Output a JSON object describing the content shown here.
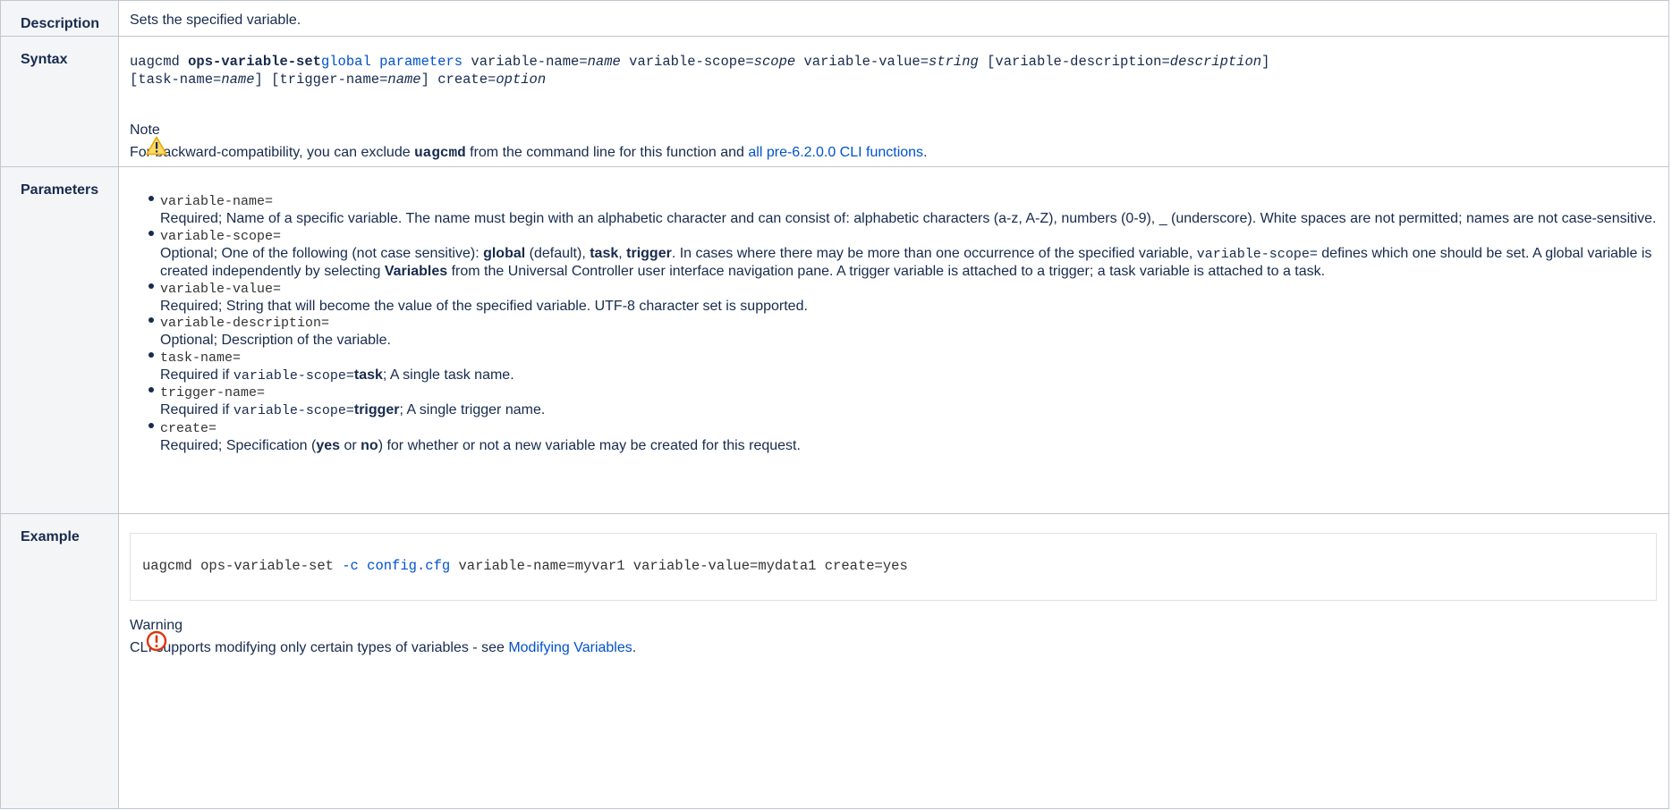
{
  "labels": {
    "description": "Description",
    "syntax": "Syntax",
    "parameters": "Parameters",
    "example": "Example"
  },
  "description": "Sets the specified variable.",
  "syntax": {
    "cmd": "uagcmd ",
    "func": "ops-variable-set",
    "global_params": "global parameters",
    "p1": " variable-name=",
    "p1v": "name",
    "p2": " variable-scope=",
    "p2v": "scope",
    "p3": " variable-value=",
    "p3v": "string",
    "p4": " [variable-description=",
    "p4v": "description",
    "p4end": "]",
    "p5": "[task-name=",
    "p5v": "name",
    "p5end": "]",
    "p6": " [trigger-name=",
    "p6v": "name",
    "p6end": "]",
    "p7": " create=",
    "p7v": "option"
  },
  "note": {
    "title": "Note",
    "icon": "warning-triangle-icon",
    "text_before": "For backward-compatibility, you can exclude ",
    "bold": "uagcmd",
    "text_after": " from the command line for this function and ",
    "link": "all pre-6.2.0.0 CLI functions",
    "end": "."
  },
  "parameters": [
    {
      "name": "variable-name=",
      "desc_html_parts": [
        "Required; Name of a specific variable. The name must begin with an alphabetic character and can consist of: alphabetic characters (a-z, A-Z), numbers (0-9), _ (underscore). White spaces are not permitted; names are not case-sensitive."
      ]
    },
    {
      "name": "variable-scope=",
      "d1": "Optional; One of the following (not case sensitive): ",
      "b1": "global",
      "d2": " (default), ",
      "b2": "task",
      "d3": ", ",
      "b3": "trigger",
      "d4": ". In cases where there may be more than one occurrence of the specified variable, ",
      "m1": "variable-scope=",
      "d5": " defines which one should be set. A global variable is created independently by selecting ",
      "b4": "Variables",
      "d6": " from the Universal Controller user interface navigation pane. A trigger variable is attached to a trigger; a task variable is attached to a task."
    },
    {
      "name": "variable-value=",
      "desc": "Required; String that will become the value of the specified variable. UTF-8 character set is supported."
    },
    {
      "name": "variable-description=",
      "desc": "Optional; Description of the variable."
    },
    {
      "name": "task-name=",
      "d1": "Required if ",
      "m1": "variable-scope=",
      "b1": "task",
      "d2": "; A single task name."
    },
    {
      "name": "trigger-name=",
      "d1": "Required if ",
      "m1": "variable-scope=",
      "b1": "trigger",
      "d2": "; A single trigger name."
    },
    {
      "name": "create=",
      "d1": "Required; Specification (",
      "b1": "yes",
      "d2": " or ",
      "b2": "no",
      "d3": ") for whether or not a new variable may be created for this request."
    }
  ],
  "example": {
    "c1": "uagcmd ops-variable-set ",
    "c2": "-c config.cfg",
    "c3": " variable-name=myvar1 variable-value=mydata1 create=yes"
  },
  "warning": {
    "title": "Warning",
    "icon": "error-circle-icon",
    "text": "CLI supports modifying only certain types of variables - see ",
    "link": "Modifying Variables",
    "end": "."
  },
  "colors": {
    "link": "#0052cc",
    "label_bg": "#f4f5f7",
    "border": "#c1c7d0",
    "warning_icon": "#ffab00",
    "error_icon": "#de350b"
  }
}
